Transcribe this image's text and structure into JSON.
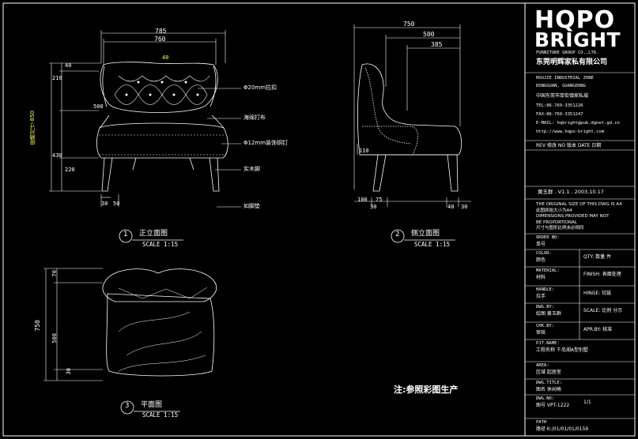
{
  "logo": {
    "line1": "HQPO",
    "line2": "BRIGHT"
  },
  "company": {
    "en": "FURNITURE GROUP CO.,LTD.",
    "cn": "东莞明辉家私有限公司",
    "addr1": "HOUJIE INDUSTRIAL ZONE",
    "addr2": "DONGGUAN, GUANGDONG",
    "addr_cn": "中国东莞市厚街镇家私城",
    "tel": "TEL:86-769-3351226",
    "fax": "FAX:86-769-3351247",
    "email": "E-MAIL: hqbright@pub.dgnet.gd.cn",
    "web": "http://www.hqpo-bright.com"
  },
  "rev_header": "REV 修改  NO 版本  DATE 日期",
  "designer_line": "黄玉群 . V1.1 . 2003.10.17",
  "notes": [
    "THE ORIGINAL SIZE OF THIS DWG IS A4",
    "此图原始大小为A4",
    "DIMENSIONS PROVIDED MAY NOT",
    "BE PROPORTIONAL",
    "尺寸与图形比例未必相同"
  ],
  "fields": [
    {
      "en": "ORDER NO:",
      "cn": "单号",
      "val": ""
    },
    {
      "en": "COLOR:",
      "cn": "颜色",
      "val": "QTY:  数量   件"
    },
    {
      "en": "MATERIAL:",
      "cn": "材料",
      "val": "FINISH: 表面处理"
    },
    {
      "en": "HANDLE:",
      "cn": "拉手",
      "val": "HINGE: 铰链"
    },
    {
      "en": "DWG.BY:",
      "cn": "绘图 黄玉群",
      "val": "SCALE: 比例  分示"
    },
    {
      "en": "CHK.BY:",
      "cn": "审核",
      "val": "APR.BY: 核准"
    },
    {
      "en": "PJT.NAME:",
      "cn": "工程名称  千岛湖A型别墅",
      "val": ""
    },
    {
      "en": "AREA:",
      "cn": "区域  起居室",
      "val": ""
    },
    {
      "en": "DWG.TITLE:",
      "cn": "图名  休闲椅",
      "val": ""
    },
    {
      "en": "DWG.NO:",
      "cn": "图号  VPT-1222",
      "val": "1/1"
    },
    {
      "en": "PATH",
      "cn": "路径  K:/01/01/01/0159",
      "val": ""
    }
  ],
  "views": [
    {
      "num": "1",
      "title": "正立面图",
      "scale": "SCALE 1:15"
    },
    {
      "num": "2",
      "title": "侧立面图",
      "scale": "SCALE 1:15"
    },
    {
      "num": "3",
      "title": "平面图",
      "scale": "SCALE 1:15"
    }
  ],
  "front_dims": {
    "top1": "785",
    "top2": "760",
    "top3": "40",
    "left_v": [
      "40",
      "210",
      "430",
      "220"
    ],
    "total_label": "座椅尺寸 850",
    "side500": "500",
    "bottom": [
      "30",
      "50"
    ]
  },
  "callouts": [
    "Φ20mm拉扣",
    "海绵打布",
    "Φ12mm装饰铜钉",
    "实木脚",
    "如脚垫"
  ],
  "side_dims": {
    "top": [
      "750",
      "500",
      "385"
    ],
    "h110": "110",
    "bottom": [
      "100",
      "75",
      "30",
      "40",
      "30"
    ]
  },
  "plan_dims": {
    "total": "750",
    "v70": "70",
    "v500": "500",
    "v30": "30"
  },
  "footnote": "注:参照彩图生产"
}
